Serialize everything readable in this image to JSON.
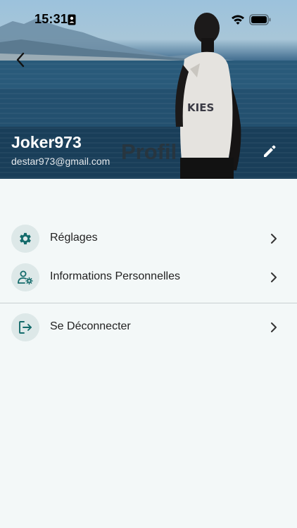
{
  "status_bar": {
    "time": "15:31",
    "icons": [
      "id-card-icon",
      "wifi-icon",
      "battery-icon"
    ]
  },
  "header": {
    "title": "Profil",
    "username": "Joker973",
    "email": "destar973@gmail.com",
    "back_icon": "chevron-left-icon",
    "edit_icon": "pencil-icon",
    "shirt_text": "KIES"
  },
  "menu": {
    "items": [
      {
        "label": "Réglages",
        "icon": "gear-icon"
      },
      {
        "label": "Informations Personnelles",
        "icon": "user-settings-icon"
      },
      {
        "label": "Se Déconnecter",
        "icon": "logout-icon"
      }
    ]
  },
  "colors": {
    "accent": "#146b6b",
    "icon_bg": "#dde8e8",
    "page_bg": "#f3f8f8",
    "divider": "#c9cfd1"
  }
}
